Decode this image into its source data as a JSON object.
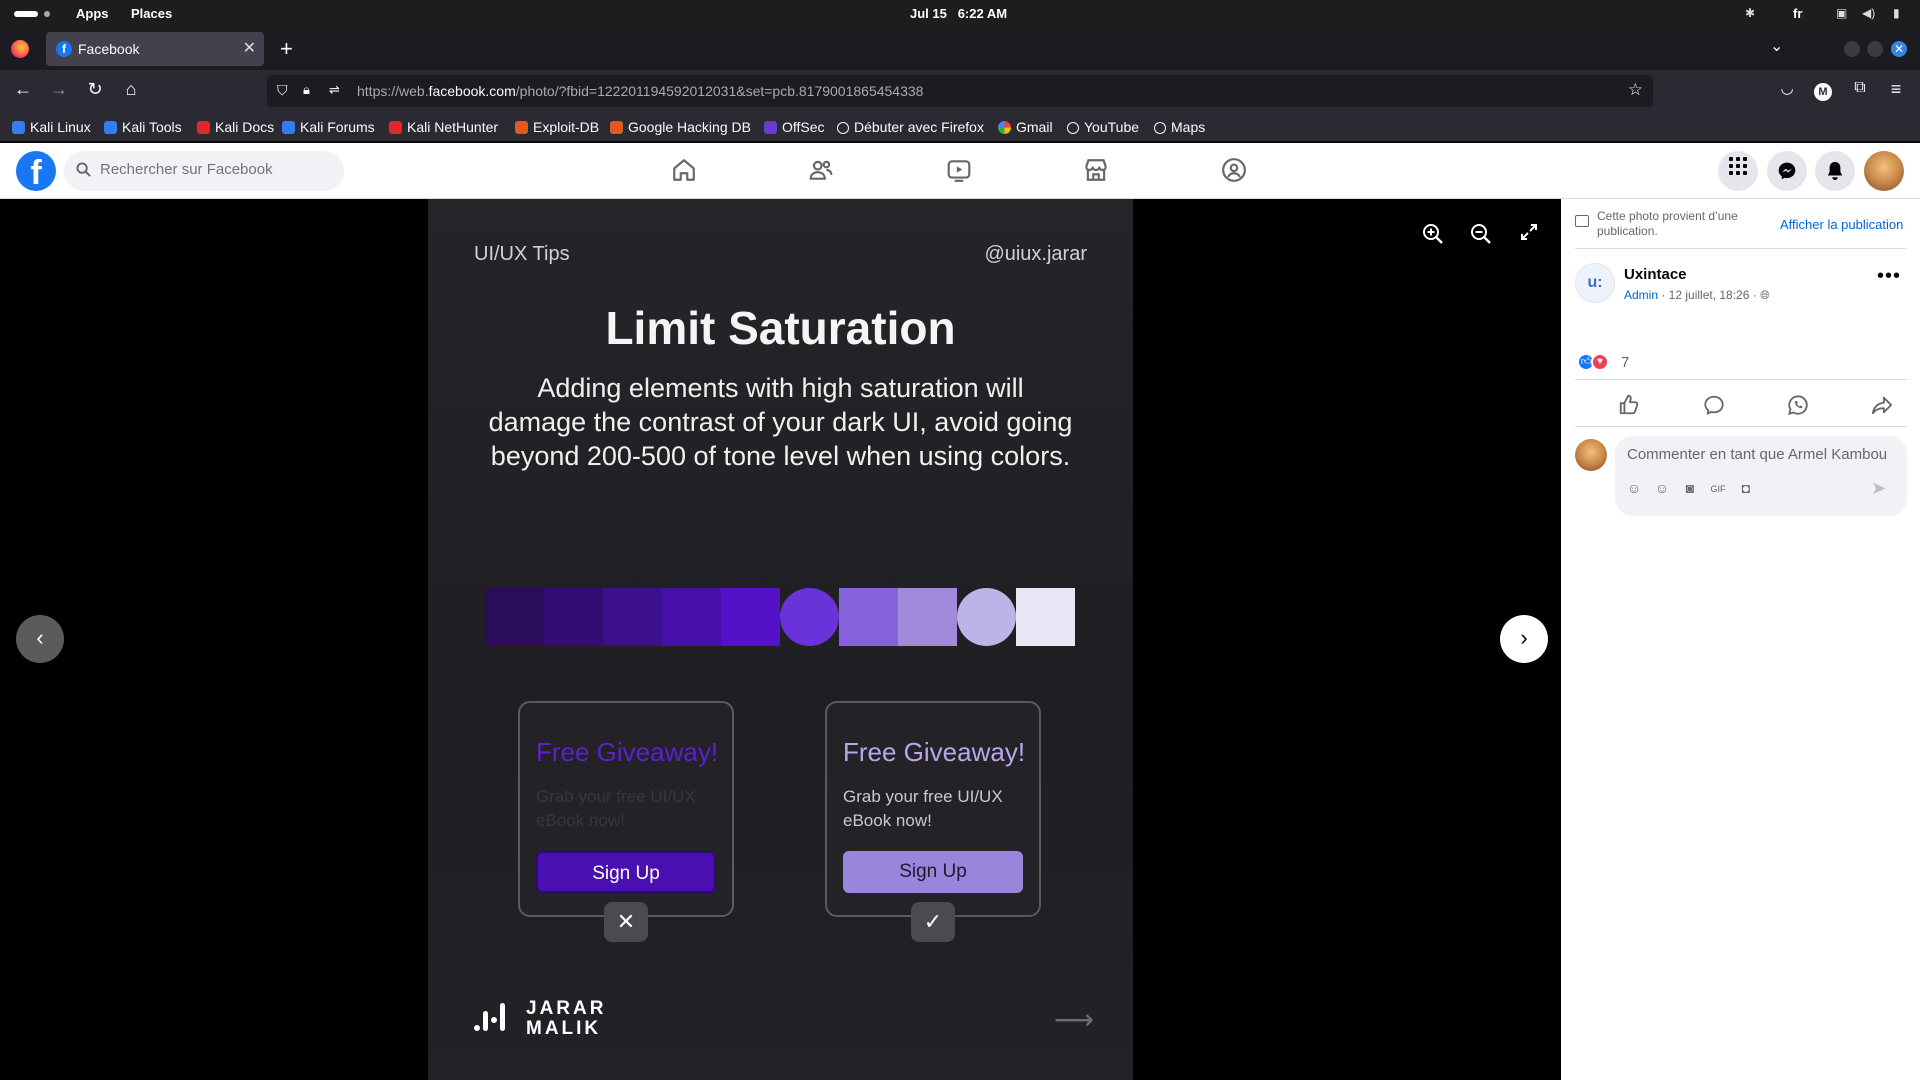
{
  "system_bar": {
    "apps": "Apps",
    "places": "Places",
    "date": "Jul 15",
    "time": "6:22 AM",
    "language": "fr"
  },
  "browser": {
    "tab_title": "Facebook",
    "tab_favicon": "f",
    "url_prefix": "https://web.",
    "url_domain": "facebook.com",
    "url_rest": "/photo/?fbid=122201194592012031&set=pcb.8179001865454338",
    "bookmarks": [
      {
        "label": "Kali Linux",
        "color": "#367bf0"
      },
      {
        "label": "Kali Tools",
        "color": "#367bf0"
      },
      {
        "label": "Kali Docs",
        "color": "#e0272b"
      },
      {
        "label": "Kali Forums",
        "color": "#367bf0"
      },
      {
        "label": "Kali NetHunter",
        "color": "#e0272b"
      },
      {
        "label": "Exploit-DB",
        "color": "#e25822"
      },
      {
        "label": "Google Hacking DB",
        "color": "#e25822"
      },
      {
        "label": "OffSec",
        "color": "#6b3bd0"
      },
      {
        "label": "Débuter avec Firefox",
        "color": "globe"
      },
      {
        "label": "Gmail",
        "color": "google"
      },
      {
        "label": "YouTube",
        "color": "globe"
      },
      {
        "label": "Maps",
        "color": "globe"
      }
    ]
  },
  "facebook": {
    "search_placeholder": "Rechercher sur Facebook",
    "brand_color": "#1877f2"
  },
  "photo": {
    "tag_left": "UI/UX Tips",
    "tag_right": "@uiux.jarar",
    "title": "Limit Saturation",
    "body": "Adding elements with high saturation will damage the contrast of your dark UI, avoid going beyond 200-500 of tone level when using colors.",
    "palette": [
      "#2b0c5c",
      "#330d72",
      "#3c0f8c",
      "#4710a8",
      "#5312c7",
      "#6a32d9",
      "#8663dd",
      "#a08ad9",
      "#beb3e6",
      "#e9e6f5"
    ],
    "card_bad": {
      "title": "Free Giveaway!",
      "body": "Grab your free UI/UX eBook  now!",
      "button": "Sign Up",
      "title_color": "#5b21d0",
      "button_color": "#4a0fb0"
    },
    "card_good": {
      "title": "Free Giveaway!",
      "body": "Grab your free UI/UX eBook  now!",
      "button": "Sign Up",
      "title_color": "#b9a7ea",
      "button_color": "#9a85dc"
    },
    "logo_line1": "JARAR",
    "logo_line2": "MALIK"
  },
  "panel": {
    "note": "Cette photo provient d’une publication.",
    "view_post": "Afficher la publication",
    "page_name": "Uxintace",
    "page_avatar": "u:",
    "role": "Admin",
    "date": " · 12 juillet, 18:26 · ",
    "reaction_count": "7",
    "comment_placeholder": "Commenter en tant que Armel Kambou"
  }
}
